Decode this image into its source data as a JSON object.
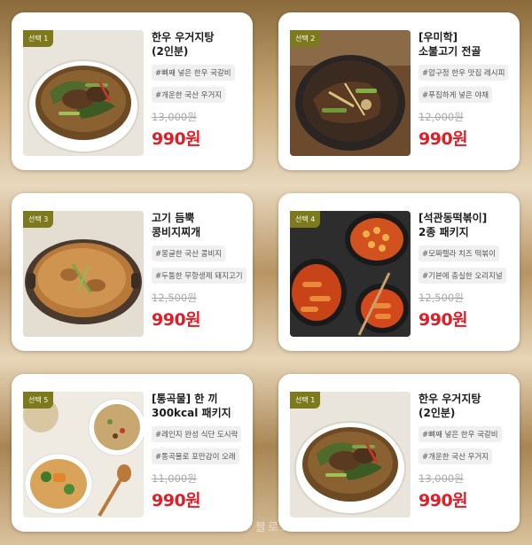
{
  "cards": [
    {
      "badge": "선택 1",
      "title": "한우 우거지탕\n(2인분)",
      "tags": [
        "#뼈째 넣은 한우 국갈비",
        "#개운한 국산 우거지"
      ],
      "old_price": "13,000원",
      "new_price": "990원",
      "image": "beef-radish-leaf-soup-image"
    },
    {
      "badge": "선택 2",
      "title": "[우미학]\n소불고기 전골",
      "tags": [
        "#압구정 한우 맛집 레시피",
        "#푸짐하게 넣은 야채"
      ],
      "old_price": "12,000원",
      "new_price": "990원",
      "image": "bulgogi-hotpot-image"
    },
    {
      "badge": "선택 3",
      "title": "고기 듬뿍\n콩비지찌개",
      "tags": [
        "#몽글한 국산 콩비지",
        "#두툼한 무항생제 돼지고기"
      ],
      "old_price": "12,500원",
      "new_price": "990원",
      "image": "soybean-stew-image"
    },
    {
      "badge": "선택 4",
      "title": "[석관동떡볶이]\n2종 패키지",
      "tags": [
        "#모짜렐라 치즈 떡볶이",
        "#기본에 충실한 오리지널"
      ],
      "old_price": "12,500원",
      "new_price": "990원",
      "image": "tteokbokki-image"
    },
    {
      "badge": "선택 5",
      "title": "[통곡물] 한 끼\n300kcal 패키지",
      "tags": [
        "#레인지 완성 식단 도시락",
        "#통곡물로 포만감이 오래"
      ],
      "old_price": "11,000원",
      "new_price": "990원",
      "image": "grain-meal-package-image"
    },
    {
      "badge": "선택 1",
      "title": "한우 우거지탕\n(2인분)",
      "tags": [
        "#뼈째 넣은 한우 국갈비",
        "#개운한 국산 우거지"
      ],
      "old_price": "13,000원",
      "new_price": "990원",
      "image": "beef-radish-leaf-soup-image"
    }
  ],
  "watermark": "마케트 블로그",
  "colors": {
    "badge": "#7c7a1c",
    "price": "#e11d25",
    "old_price": "#a8a8a8",
    "background": "#c9a978"
  }
}
